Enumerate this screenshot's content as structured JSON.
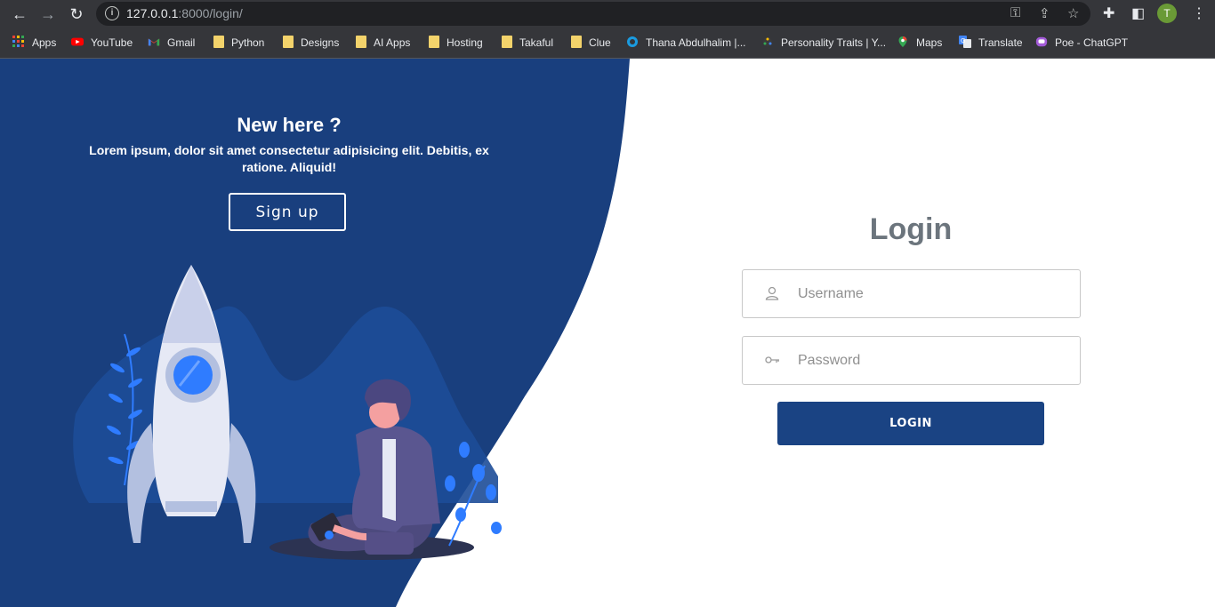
{
  "browser": {
    "url_host": "127.0.0.1",
    "url_path": ":8000/login/",
    "profile_initial": "T",
    "bookmarks": [
      {
        "label": "Apps",
        "icon": "apps-grid-icon"
      },
      {
        "label": "YouTube",
        "icon": "youtube-icon"
      },
      {
        "label": "Gmail",
        "icon": "gmail-icon"
      },
      {
        "label": "Python",
        "icon": "folder-icon"
      },
      {
        "label": "Designs",
        "icon": "folder-icon"
      },
      {
        "label": "AI Apps",
        "icon": "folder-icon"
      },
      {
        "label": "Hosting",
        "icon": "folder-icon"
      },
      {
        "label": "Takaful",
        "icon": "folder-icon"
      },
      {
        "label": "Clue",
        "icon": "folder-icon"
      },
      {
        "label": "Thana Abdulhalim |...",
        "icon": "circle-icon"
      },
      {
        "label": "Personality Traits | Y...",
        "icon": "site-icon"
      },
      {
        "label": "Maps",
        "icon": "maps-icon"
      },
      {
        "label": "Translate",
        "icon": "translate-icon"
      },
      {
        "label": "Poe - ChatGPT",
        "icon": "poe-icon"
      }
    ]
  },
  "left_panel": {
    "title": "New here ?",
    "description": "Lorem ipsum, dolor sit amet consectetur adipisicing elit. Debitis, ex ratione. Aliquid!",
    "signup_label": "Sign up"
  },
  "login": {
    "title": "Login",
    "username_placeholder": "Username",
    "password_placeholder": "Password",
    "button_label": "LOGIN"
  },
  "colors": {
    "primary": "#1a4383",
    "panel": "#193f7e",
    "accent": "#2f7cff"
  }
}
